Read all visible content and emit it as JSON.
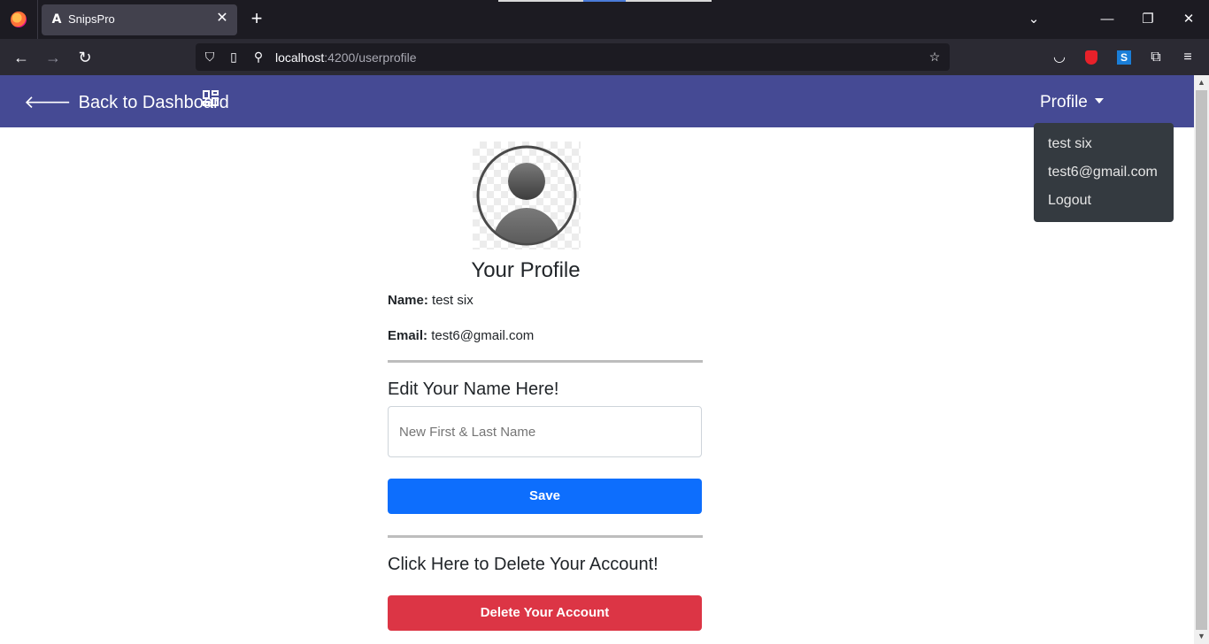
{
  "browser": {
    "tab_title": "SnipsPro",
    "tab_icon_glyph": "A",
    "url_host": "localhost",
    "url_path": ":4200/userprofile",
    "window_controls": {
      "minimize": "—",
      "restore": "❐",
      "close": "✕"
    }
  },
  "header": {
    "back_label": "Back to Dashboard",
    "profile_label": "Profile",
    "color": "#454a94"
  },
  "dropdown": {
    "items": [
      {
        "label": "test six"
      },
      {
        "label": "test6@gmail.com"
      },
      {
        "label": "Logout"
      }
    ]
  },
  "profile": {
    "title": "Your Profile",
    "name_label": "Name:",
    "name_value": "test six",
    "email_label": "Email:",
    "email_value": "test6@gmail.com"
  },
  "edit": {
    "title": "Edit Your Name Here!",
    "placeholder": "New First & Last Name",
    "save_label": "Save"
  },
  "delete": {
    "title": "Click Here to Delete Your Account!",
    "button_label": "Delete Your Account"
  },
  "colors": {
    "save": "#0d6efd",
    "delete": "#dc3545",
    "dropdown_bg": "#343a40"
  }
}
